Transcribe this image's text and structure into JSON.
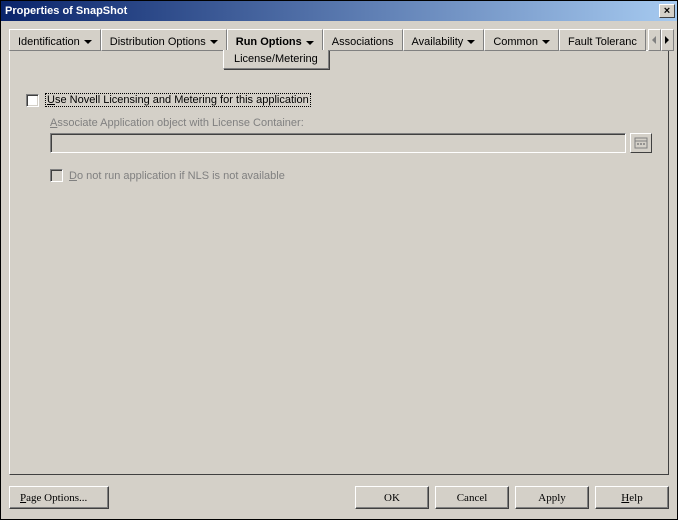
{
  "window": {
    "title": "Properties of SnapShot"
  },
  "tabs": {
    "identification": "Identification",
    "distribution": "Distribution Options",
    "run": "Run Options",
    "associations": "Associations",
    "availability": "Availability",
    "common": "Common",
    "fault": "Fault Toleranc"
  },
  "subtab": {
    "license_metering": "License/Metering"
  },
  "form": {
    "use_novell": {
      "u": "U",
      "rest": "se Novell Licensing and Metering for this application"
    },
    "assoc_label": {
      "u": "A",
      "rest": "ssociate Application object with License Container:"
    },
    "assoc_value": "",
    "nls": {
      "u": "D",
      "rest": "o not run application if NLS is not available"
    }
  },
  "footer": {
    "page_options": {
      "u": "P",
      "rest": "age Options..."
    },
    "ok": "OK",
    "cancel": "Cancel",
    "apply": "Apply",
    "help": {
      "u": "H",
      "rest": "elp"
    }
  }
}
